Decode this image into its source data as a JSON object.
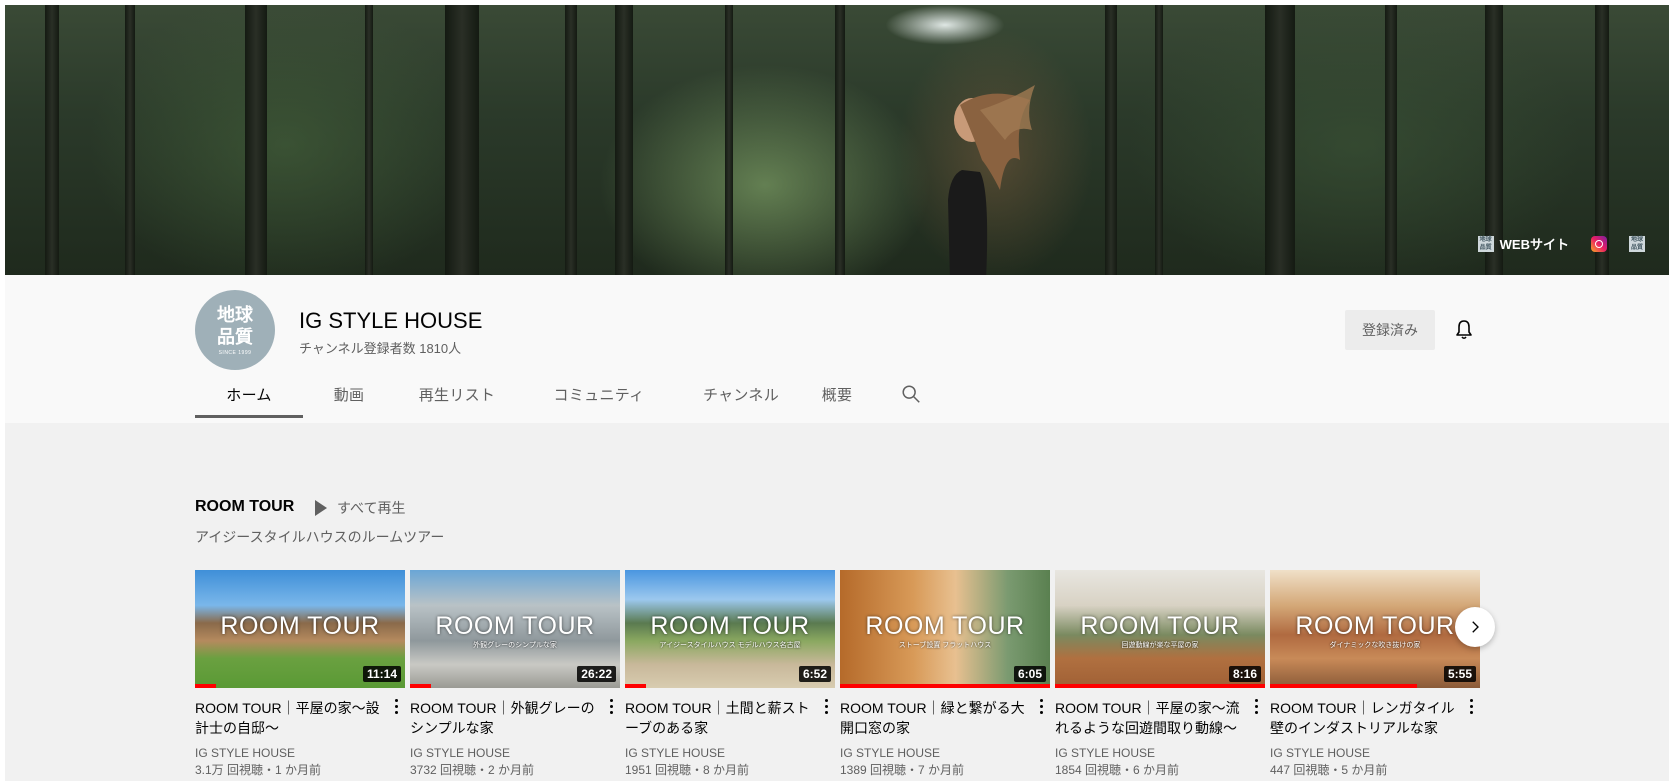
{
  "banner": {
    "links": [
      {
        "label": "WEBサイト",
        "icon": "brand-logo-icon"
      },
      {
        "label": "",
        "icon": "instagram-icon"
      },
      {
        "label": "",
        "icon": "brand-logo-icon"
      }
    ],
    "mini_logo_text": "地球品質"
  },
  "channel": {
    "avatar_text": "地球\n品質",
    "avatar_sub": "SINCE 1999",
    "name": "IG STYLE HOUSE",
    "subscribers": "チャンネル登録者数 1810人",
    "subscribed_label": "登録済み"
  },
  "tabs": [
    {
      "label": "ホーム",
      "active": true
    },
    {
      "label": "動画"
    },
    {
      "label": "再生リスト"
    },
    {
      "label": "コミュニティ"
    },
    {
      "label": "チャンネル"
    },
    {
      "label": "概要"
    }
  ],
  "shelf": {
    "title": "ROOM TOUR",
    "play_all": "すべて再生",
    "description": "アイジースタイルハウスのルームツアー"
  },
  "videos": [
    {
      "thumb_text": "ROOM TOUR",
      "thumb_sub": "",
      "duration": "11:14",
      "progress": 0.1,
      "title": "ROOM TOUR｜平屋の家〜設計士の自邸〜",
      "channel": "IG STYLE HOUSE",
      "meta": "3.1万 回視聴・1 か月前",
      "bg": "linear-gradient(180deg,#3f8fd8 0%,#7ab7ea 30%,#8a6a4a 45%,#b58a5e 60%,#6aa040 75%,#5a9a35 100%)"
    },
    {
      "thumb_text": "ROOM TOUR",
      "thumb_sub": "外観グレーのシンプルな家",
      "duration": "26:22",
      "progress": 0.1,
      "title": "ROOM TOUR｜外観グレーのシンプルな家",
      "channel": "IG STYLE HOUSE",
      "meta": "3732 回視聴・2 か月前",
      "bg": "linear-gradient(180deg,#6aa6d6 0%,#b9c2c6 30%,#8f989c 60%,#c9c9c4 80%,#9a9a94 100%)"
    },
    {
      "thumb_text": "ROOM TOUR",
      "thumb_sub": "アイジースタイルハウス モデルハウス名古屋",
      "duration": "6:52",
      "progress": 0.1,
      "title": "ROOM TOUR｜土間と薪ストーブのある家",
      "channel": "IG STYLE HOUSE",
      "meta": "1951 回視聴・8 か月前",
      "bg": "linear-gradient(180deg,#4a96e0 0%,#9cc8ee 25%,#5a7a50 45%,#8aa860 60%,#c8b89a 80%,#d8ccb0 100%)"
    },
    {
      "thumb_text": "ROOM TOUR",
      "thumb_sub": "ストーブ設置 フラットハウス",
      "duration": "6:05",
      "progress": 1.0,
      "title": "ROOM TOUR｜緑と繋がる大開口窓の家",
      "channel": "IG STYLE HOUSE",
      "meta": "1389 回視聴・7 か月前",
      "bg": "linear-gradient(90deg,#b56a2a 0%,#d89a58 35%,#e8c090 55%,#7a9a70 80%,#5a8050 100%)"
    },
    {
      "thumb_text": "ROOM TOUR",
      "thumb_sub": "回遊動線が楽な平屋の家",
      "duration": "8:16",
      "progress": 1.0,
      "title": "ROOM TOUR｜平屋の家〜流れるような回遊間取り動線〜",
      "channel": "IG STYLE HOUSE",
      "meta": "1854 回視聴・6 か月前",
      "bg": "linear-gradient(180deg,#e8e6e0 0%,#d8d2c4 30%,#7a8a60 55%,#b07040 75%,#a06035 100%)"
    },
    {
      "thumb_text": "ROOM TOUR",
      "thumb_sub": "ダイナミックな吹き抜けの家",
      "duration": "5:55",
      "progress": 0.7,
      "title": "ROOM TOUR｜レンガタイル壁のインダストリアルな家",
      "channel": "IG STYLE HOUSE",
      "meta": "447 回視聴・5 か月前",
      "bg": "linear-gradient(180deg,#f0e0c8 0%,#d4a878 30%,#b06a40 55%,#c88a58 75%,#8a5a38 100%)"
    }
  ],
  "colors": {
    "accent_red": "#ff0000",
    "text_secondary": "#606060",
    "header_bg": "#f9f9f9",
    "content_bg": "#f1f1f1"
  }
}
